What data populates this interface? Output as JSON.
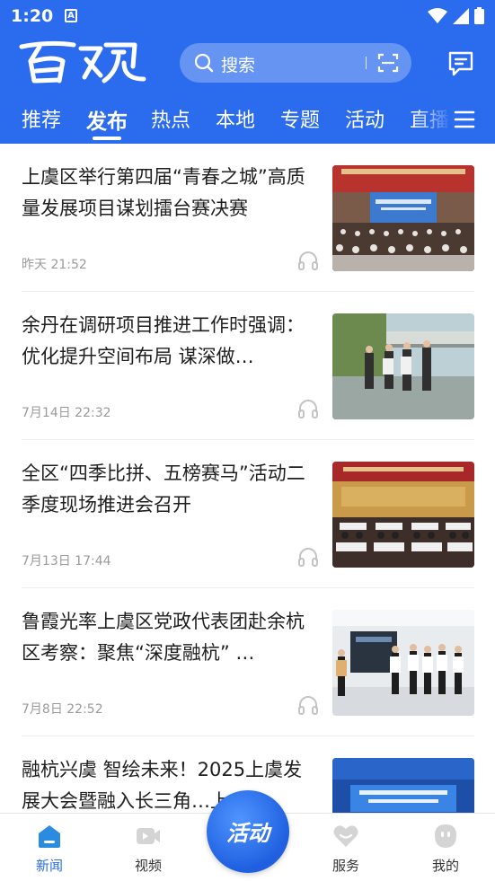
{
  "status_bar": {
    "time": "1:20",
    "a_icon": "A"
  },
  "header": {
    "logo_text": "百观",
    "search_placeholder": "搜索",
    "icons": [
      "search-icon",
      "scan-icon",
      "message-icon"
    ],
    "accent_color": "#2b6bed"
  },
  "tabs": [
    {
      "label": "推荐"
    },
    {
      "label": "发布"
    },
    {
      "label": "热点"
    },
    {
      "label": "本地"
    },
    {
      "label": "专题"
    },
    {
      "label": "活动"
    },
    {
      "label": "直播"
    }
  ],
  "active_tab": "发布",
  "news": [
    {
      "title": "上虞区举行第四届“青春之城”高质量发展项目谋划擂台赛决赛",
      "time": "昨天 21:52",
      "thumb": "meeting-stage-photo"
    },
    {
      "title": "余丹在调研项目推进工作时强调：优化提升空间布局  谋深做…",
      "time": "7月14日 22:32",
      "thumb": "outdoor-inspection-photo"
    },
    {
      "title": "全区“四季比拼、五榜赛马”活动二季度现场推进会召开",
      "time": "7月13日 17:44",
      "thumb": "conference-hall-photo"
    },
    {
      "title": "鲁霞光率上虞区党政代表团赴余杭区考察：聚焦“深度融杭” …",
      "time": "7月8日 22:52",
      "thumb": "exhibition-visit-photo"
    },
    {
      "title": "融杭兴虞 智绘未来！2025上虞发展大会暨融入长三角…上…",
      "time": "",
      "thumb": "event-stage-photo"
    }
  ],
  "bottom_nav": [
    {
      "label": "新闻",
      "icon": "home-icon"
    },
    {
      "label": "视频",
      "icon": "video-icon"
    },
    {
      "label": "服务",
      "icon": "heart-icon"
    },
    {
      "label": "我的",
      "icon": "profile-icon"
    }
  ],
  "center_button": {
    "label": "活动"
  }
}
